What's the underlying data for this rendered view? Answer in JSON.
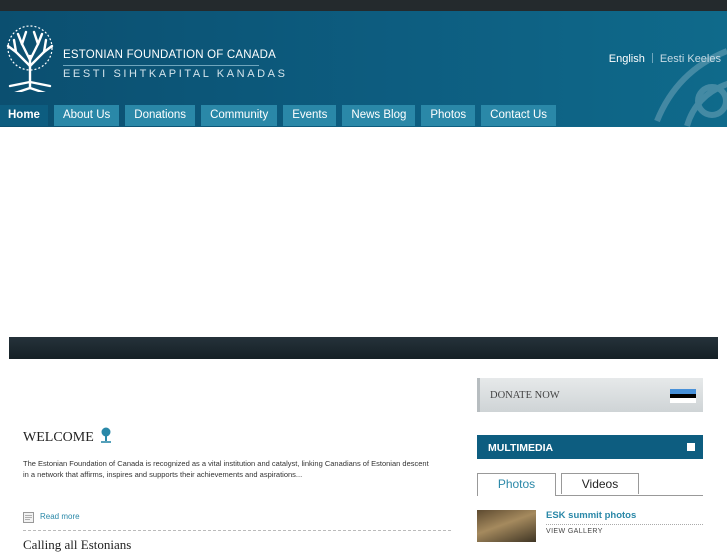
{
  "header": {
    "org_name": "ESTONIAN FOUNDATION OF CANADA",
    "org_name_estonian": "EESTI SIHTKAPITAL KANADAS",
    "languages": [
      "English",
      "Eesti Keeles"
    ]
  },
  "nav": {
    "items": [
      {
        "label": "Home",
        "active": true
      },
      {
        "label": "About Us"
      },
      {
        "label": "Donations"
      },
      {
        "label": "Community"
      },
      {
        "label": "Events"
      },
      {
        "label": "News Blog"
      },
      {
        "label": "Photos"
      },
      {
        "label": "Contact Us"
      }
    ]
  },
  "welcome": {
    "heading": "WELCOME",
    "body": "The Estonian Foundation of Canada is recognized as a vital institution and catalyst, linking Canadians of Estonian descent in a network that affirms, inspires and supports their achievements and aspirations...",
    "read_more": "Read more",
    "next_heading": "Calling all Estonians"
  },
  "sidebar": {
    "donate_label": "DONATE NOW",
    "multimedia_label": "MULTIMEDIA",
    "tabs": [
      "Photos",
      "Videos"
    ],
    "gallery_item": {
      "title": "ESK summit photos",
      "subtitle": "VIEW GALLERY"
    }
  },
  "colors": {
    "brand_dark": "#0d5d80",
    "nav_tab": "#2a88a8",
    "link": "#2a88a8",
    "flag": [
      "#4891d9",
      "#000000",
      "#ffffff"
    ]
  },
  "icons": [
    "tree-logo-icon",
    "tree-icon",
    "document-icon",
    "flag-icon",
    "square-icon"
  ]
}
